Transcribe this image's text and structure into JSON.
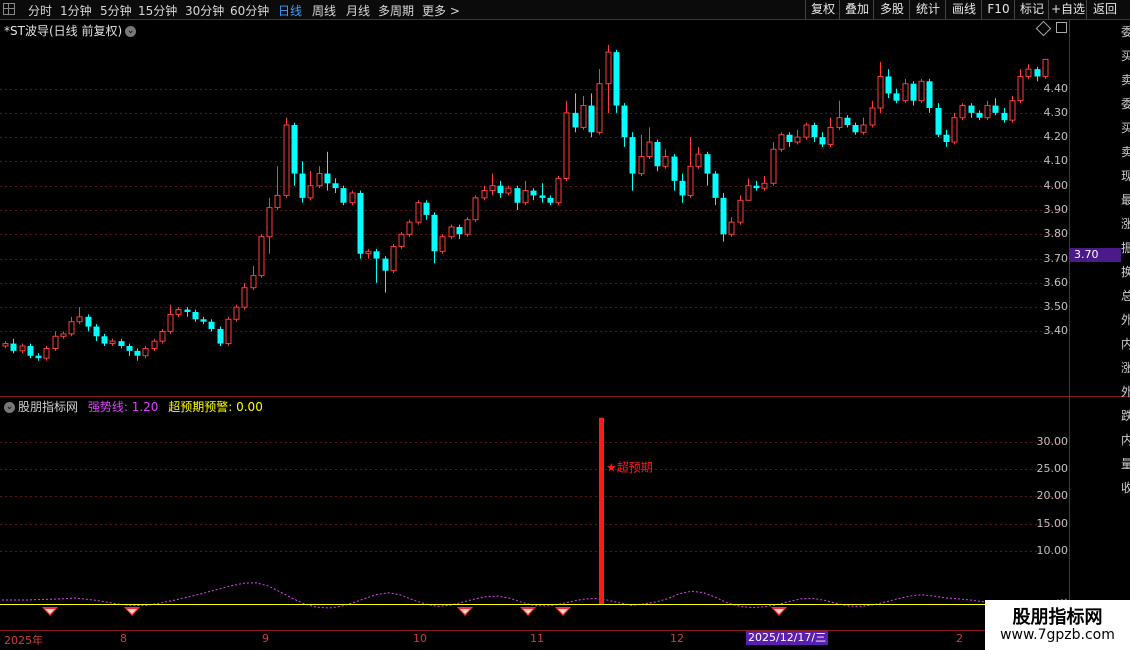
{
  "toolbar": {
    "period_tabs": [
      {
        "label": "分时",
        "active": false
      },
      {
        "label": "1分钟",
        "active": false
      },
      {
        "label": "5分钟",
        "active": false
      },
      {
        "label": "15分钟",
        "active": false
      },
      {
        "label": "30分钟",
        "active": false
      },
      {
        "label": "60分钟",
        "active": false
      },
      {
        "label": "日线",
        "active": true
      },
      {
        "label": "周线",
        "active": false
      },
      {
        "label": "月线",
        "active": false
      },
      {
        "label": "多周期",
        "active": false
      },
      {
        "label": "更多 >",
        "active": false
      }
    ],
    "right_buttons": [
      "复权",
      "叠加",
      "多股",
      "统计",
      "画线",
      "F10",
      "标记",
      "+自选",
      "返回"
    ]
  },
  "price_chart": {
    "title": "*ST波导(日线 前复权)",
    "y_ticks": [
      "4.40",
      "4.30",
      "4.20",
      "4.10",
      "4.00",
      "3.90",
      "3.80",
      "3.70",
      "3.60",
      "3.50",
      "3.40"
    ],
    "current_price": "3.70",
    "side_strip_text": "委买卖委买卖现最涨振换总外内涨外跌内量收"
  },
  "indicator": {
    "name": "股朋指标网",
    "line1_label": "强势线: 1.20",
    "line2_label": "超预期预警: 0.00",
    "signal_label": "★超预期",
    "y_ticks": [
      "30.00",
      "25.00",
      "20.00",
      "15.00",
      "10.00"
    ]
  },
  "x_axis": {
    "labels": [
      "2025年",
      "8",
      "9",
      "10",
      "11",
      "12",
      "2"
    ],
    "cursor_date": "2025/12/17/三"
  },
  "watermark": {
    "line1": "股朋指标网",
    "line2": "www.7gpzb.com"
  },
  "colors": {
    "up": "#ff3b3b",
    "down": "#00ffff",
    "signal": "#ff1a1a",
    "strong_line": "#e040ff",
    "alert_line": "#ffff00",
    "accent_tab": "#3aa0ff",
    "price_tag": "#4a1a8a"
  },
  "chart_data": [
    {
      "type": "candlestick",
      "title": "*ST波导(日线 前复权)",
      "ylim": [
        3.2,
        4.6
      ],
      "candles": [
        [
          3.34,
          3.35,
          3.33,
          3.36
        ],
        [
          3.35,
          3.32,
          3.31,
          3.37
        ],
        [
          3.32,
          3.34,
          3.31,
          3.35
        ],
        [
          3.34,
          3.3,
          3.29,
          3.35
        ],
        [
          3.3,
          3.29,
          3.28,
          3.31
        ],
        [
          3.29,
          3.33,
          3.28,
          3.34
        ],
        [
          3.33,
          3.38,
          3.32,
          3.4
        ],
        [
          3.38,
          3.39,
          3.37,
          3.4
        ],
        [
          3.39,
          3.44,
          3.38,
          3.46
        ],
        [
          3.44,
          3.46,
          3.43,
          3.5
        ],
        [
          3.46,
          3.42,
          3.4,
          3.47
        ],
        [
          3.42,
          3.38,
          3.36,
          3.43
        ],
        [
          3.38,
          3.35,
          3.34,
          3.39
        ],
        [
          3.35,
          3.36,
          3.34,
          3.37
        ],
        [
          3.36,
          3.34,
          3.33,
          3.37
        ],
        [
          3.34,
          3.32,
          3.3,
          3.35
        ],
        [
          3.32,
          3.3,
          3.28,
          3.33
        ],
        [
          3.3,
          3.33,
          3.29,
          3.34
        ],
        [
          3.33,
          3.36,
          3.32,
          3.37
        ],
        [
          3.36,
          3.4,
          3.35,
          3.41
        ],
        [
          3.4,
          3.47,
          3.39,
          3.51
        ],
        [
          3.47,
          3.49,
          3.46,
          3.5
        ],
        [
          3.49,
          3.48,
          3.46,
          3.5
        ],
        [
          3.48,
          3.45,
          3.44,
          3.49
        ],
        [
          3.45,
          3.44,
          3.43,
          3.46
        ],
        [
          3.44,
          3.41,
          3.4,
          3.45
        ],
        [
          3.41,
          3.35,
          3.34,
          3.42
        ],
        [
          3.35,
          3.45,
          3.34,
          3.46
        ],
        [
          3.45,
          3.5,
          3.44,
          3.51
        ],
        [
          3.5,
          3.58,
          3.49,
          3.6
        ],
        [
          3.58,
          3.63,
          3.57,
          3.67
        ],
        [
          3.63,
          3.79,
          3.62,
          3.8
        ],
        [
          3.79,
          3.91,
          3.72,
          3.95
        ],
        [
          3.91,
          3.96,
          3.9,
          4.08
        ],
        [
          3.96,
          4.25,
          3.95,
          4.28
        ],
        [
          4.25,
          4.05,
          4.0,
          4.26
        ],
        [
          4.05,
          3.95,
          3.93,
          4.1
        ],
        [
          3.95,
          4.0,
          3.94,
          4.06
        ],
        [
          4.0,
          4.05,
          3.99,
          4.08
        ],
        [
          4.05,
          4.01,
          3.98,
          4.14
        ],
        [
          4.01,
          3.99,
          3.97,
          4.03
        ],
        [
          3.99,
          3.93,
          3.92,
          4.0
        ],
        [
          3.93,
          3.97,
          3.92,
          3.98
        ],
        [
          3.97,
          3.72,
          3.7,
          3.98
        ],
        [
          3.72,
          3.73,
          3.7,
          3.74
        ],
        [
          3.73,
          3.7,
          3.6,
          3.74
        ],
        [
          3.7,
          3.65,
          3.56,
          3.71
        ],
        [
          3.65,
          3.75,
          3.64,
          3.76
        ],
        [
          3.75,
          3.8,
          3.74,
          3.81
        ],
        [
          3.8,
          3.85,
          3.79,
          3.86
        ],
        [
          3.85,
          3.93,
          3.84,
          3.94
        ],
        [
          3.93,
          3.88,
          3.86,
          3.94
        ],
        [
          3.88,
          3.73,
          3.68,
          3.89
        ],
        [
          3.73,
          3.79,
          3.72,
          3.8
        ],
        [
          3.79,
          3.83,
          3.78,
          3.84
        ],
        [
          3.83,
          3.8,
          3.78,
          3.84
        ],
        [
          3.8,
          3.86,
          3.79,
          3.87
        ],
        [
          3.86,
          3.95,
          3.85,
          3.96
        ],
        [
          3.95,
          3.98,
          3.94,
          4.0
        ],
        [
          3.98,
          4.0,
          3.96,
          4.05
        ],
        [
          4.0,
          3.97,
          3.95,
          4.02
        ],
        [
          3.97,
          3.99,
          3.96,
          4.0
        ],
        [
          3.99,
          3.93,
          3.9,
          4.0
        ],
        [
          3.93,
          3.98,
          3.92,
          4.02
        ],
        [
          3.98,
          3.96,
          3.94,
          3.99
        ],
        [
          3.96,
          3.95,
          3.93,
          4.01
        ],
        [
          3.95,
          3.93,
          3.92,
          3.96
        ],
        [
          3.93,
          4.03,
          3.92,
          4.04
        ],
        [
          4.03,
          4.3,
          4.02,
          4.35
        ],
        [
          4.3,
          4.24,
          4.22,
          4.38
        ],
        [
          4.24,
          4.33,
          4.23,
          4.37
        ],
        [
          4.33,
          4.22,
          4.2,
          4.38
        ],
        [
          4.22,
          4.42,
          4.21,
          4.48
        ],
        [
          4.42,
          4.55,
          4.3,
          4.58
        ],
        [
          4.55,
          4.33,
          4.3,
          4.56
        ],
        [
          4.33,
          4.2,
          4.16,
          4.34
        ],
        [
          4.2,
          4.05,
          3.98,
          4.22
        ],
        [
          4.05,
          4.12,
          4.04,
          4.21
        ],
        [
          4.12,
          4.18,
          4.11,
          4.24
        ],
        [
          4.18,
          4.08,
          4.06,
          4.19
        ],
        [
          4.08,
          4.12,
          4.07,
          4.15
        ],
        [
          4.12,
          4.02,
          3.98,
          4.13
        ],
        [
          4.02,
          3.96,
          3.93,
          4.05
        ],
        [
          3.96,
          4.08,
          3.95,
          4.2
        ],
        [
          4.08,
          4.13,
          4.07,
          4.16
        ],
        [
          4.13,
          4.05,
          4.0,
          4.14
        ],
        [
          4.05,
          3.95,
          3.92,
          4.06
        ],
        [
          3.95,
          3.8,
          3.77,
          3.97
        ],
        [
          3.8,
          3.85,
          3.79,
          3.87
        ],
        [
          3.85,
          3.94,
          3.84,
          3.96
        ],
        [
          3.94,
          4.0,
          3.98,
          4.03
        ],
        [
          4.0,
          3.99,
          3.98,
          4.02
        ],
        [
          3.99,
          4.01,
          3.98,
          4.04
        ],
        [
          4.01,
          4.15,
          4.0,
          4.18
        ],
        [
          4.15,
          4.21,
          4.14,
          4.22
        ],
        [
          4.21,
          4.18,
          4.16,
          4.22
        ],
        [
          4.18,
          4.2,
          4.17,
          4.23
        ],
        [
          4.2,
          4.25,
          4.19,
          4.26
        ],
        [
          4.25,
          4.2,
          4.18,
          4.26
        ],
        [
          4.2,
          4.17,
          4.16,
          4.22
        ],
        [
          4.17,
          4.24,
          4.16,
          4.28
        ],
        [
          4.24,
          4.28,
          4.23,
          4.35
        ],
        [
          4.28,
          4.25,
          4.24,
          4.29
        ],
        [
          4.25,
          4.22,
          4.21,
          4.26
        ],
        [
          4.22,
          4.25,
          4.21,
          4.28
        ],
        [
          4.25,
          4.32,
          4.24,
          4.35
        ],
        [
          4.32,
          4.45,
          4.3,
          4.51
        ],
        [
          4.45,
          4.38,
          4.36,
          4.48
        ],
        [
          4.38,
          4.35,
          4.34,
          4.4
        ],
        [
          4.35,
          4.42,
          4.34,
          4.44
        ],
        [
          4.42,
          4.35,
          4.33,
          4.43
        ],
        [
          4.35,
          4.43,
          4.34,
          4.44
        ],
        [
          4.43,
          4.32,
          4.3,
          4.44
        ],
        [
          4.32,
          4.21,
          4.2,
          4.34
        ],
        [
          4.21,
          4.18,
          4.16,
          4.23
        ],
        [
          4.18,
          4.28,
          4.17,
          4.3
        ],
        [
          4.28,
          4.33,
          4.27,
          4.34
        ],
        [
          4.33,
          4.3,
          4.28,
          4.34
        ],
        [
          4.3,
          4.28,
          4.27,
          4.31
        ],
        [
          4.28,
          4.33,
          4.27,
          4.35
        ],
        [
          4.33,
          4.3,
          4.29,
          4.36
        ],
        [
          4.3,
          4.27,
          4.26,
          4.32
        ],
        [
          4.27,
          4.35,
          4.26,
          4.37
        ],
        [
          4.35,
          4.45,
          4.34,
          4.48
        ],
        [
          4.45,
          4.48,
          4.44,
          4.5
        ],
        [
          4.48,
          4.45,
          4.43,
          4.49
        ],
        [
          4.45,
          4.52,
          4.44,
          4.52
        ]
      ],
      "current_price": 3.7
    },
    {
      "type": "line",
      "title": "股朋指标网",
      "ylim": [
        0,
        35
      ],
      "series": [
        {
          "name": "强势线",
          "value": 1.2
        },
        {
          "name": "超预期预警",
          "value": 0.0
        }
      ],
      "strong_line_values": [
        1.0,
        1.0,
        1.0,
        1.1,
        1.2,
        1.3,
        1.5,
        1.2,
        0.8,
        0.3,
        -0.2,
        -0.4,
        -0.3,
        0.2,
        0.8,
        1.5,
        2.2,
        3.0,
        3.8,
        4.6,
        5.2,
        5.3,
        4.5,
        3.0,
        1.4,
        0.0,
        -0.8,
        -1.0,
        -0.6,
        0.3,
        1.4,
        2.4,
        2.8,
        2.2,
        1.0,
        0.0,
        -0.6,
        -0.3,
        0.4,
        1.2,
        1.8,
        2.0,
        1.4,
        0.4,
        -0.4,
        -0.5,
        -0.1,
        0.6,
        1.2,
        1.4,
        1.0,
        0.3,
        -0.3,
        0.0,
        0.5,
        1.3,
        2.6,
        3.2,
        2.8,
        1.6,
        0.2,
        -0.6,
        -0.9,
        -0.7,
        -0.2,
        0.6,
        1.3,
        1.4,
        0.9,
        0.1,
        -0.5,
        -0.6,
        -0.2,
        0.5,
        1.3,
        2.0,
        2.3,
        2.0,
        1.5,
        1.3,
        1.0,
        0.6,
        0.0,
        -0.5,
        -0.6,
        -0.3,
        0.3,
        0.9,
        1.2
      ],
      "alert_signals": [
        {
          "x": 601,
          "value": 34.5,
          "label": "★超预期"
        }
      ],
      "marker_x": [
        50,
        132,
        465,
        528,
        563,
        779
      ]
    }
  ]
}
